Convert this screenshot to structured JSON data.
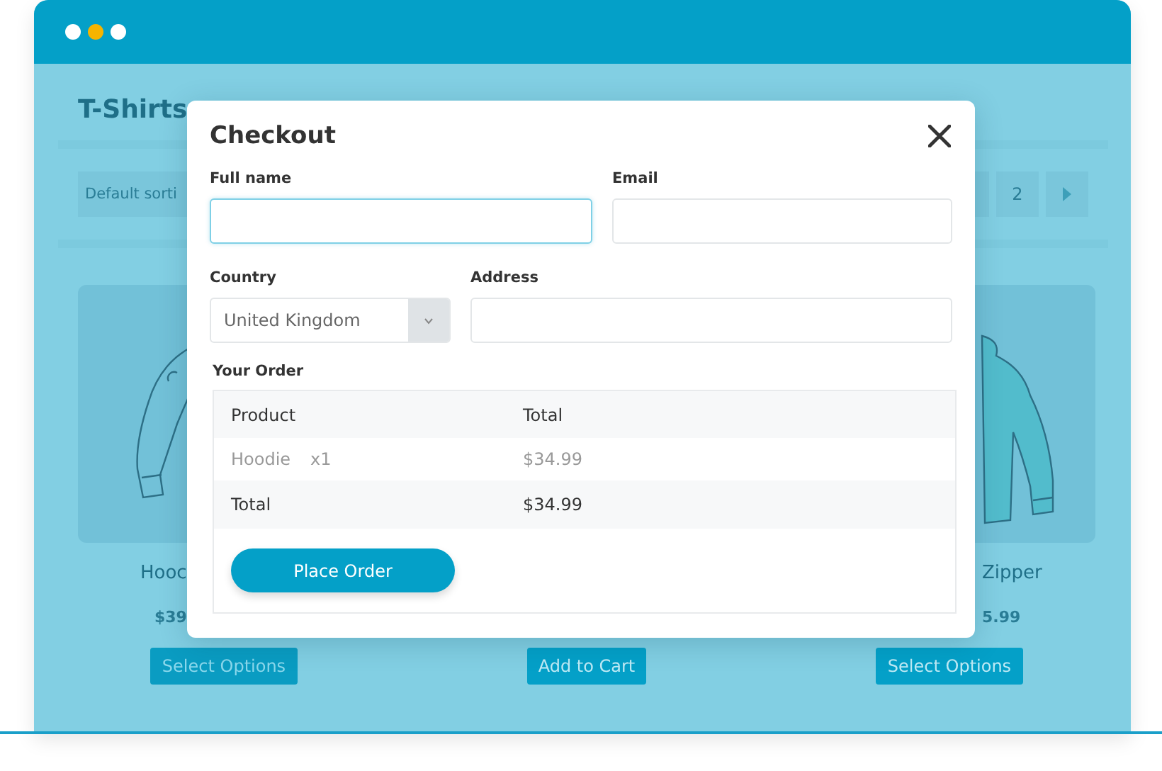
{
  "window": {
    "dots": [
      {
        "color": "#ffffff"
      },
      {
        "color": "#f6b400"
      },
      {
        "color": "#ffffff"
      }
    ]
  },
  "page": {
    "title": "T-Shirts",
    "sort": "Default sorti",
    "pages": [
      {
        "label": "2",
        "selected": false
      }
    ],
    "products": [
      {
        "name": "Hooc",
        "price": "$39",
        "button": "Select Options",
        "disabled": true
      },
      {
        "button": "Add to Cart",
        "disabled": false
      },
      {
        "name": "Zipper",
        "price": "5.99",
        "button": "Select Options",
        "disabled": false
      }
    ]
  },
  "modal": {
    "title": "Checkout",
    "fields": [
      {
        "label": "Full name",
        "kind": "input",
        "focused": true
      },
      {
        "label": "Email",
        "kind": "input",
        "focused": false
      },
      {
        "label": "Country",
        "kind": "select",
        "value": "United Kingdom"
      },
      {
        "label": "Address",
        "kind": "input",
        "focused": false
      }
    ],
    "order": {
      "heading": "Your Order",
      "columns": [
        "Product",
        "Total"
      ],
      "rows": [
        {
          "kind": "item",
          "product": "Hoodie",
          "qty": "x1",
          "total": "$34.99"
        },
        {
          "kind": "total",
          "product": "Total",
          "total": "$34.99"
        }
      ]
    },
    "button": "Place Order"
  }
}
